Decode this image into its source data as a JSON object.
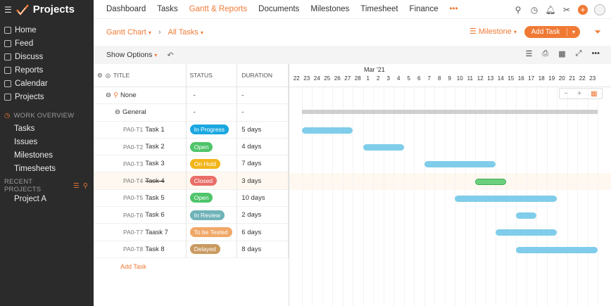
{
  "app": {
    "title": "Projects"
  },
  "sidebar": {
    "items": [
      {
        "label": "Home",
        "icon": "home-icon"
      },
      {
        "label": "Feed",
        "icon": "feed-icon"
      },
      {
        "label": "Discuss",
        "icon": "discuss-icon"
      },
      {
        "label": "Reports",
        "icon": "reports-icon"
      },
      {
        "label": "Calendar",
        "icon": "calendar-icon"
      },
      {
        "label": "Projects",
        "icon": "projects-icon"
      }
    ],
    "work_overview": {
      "heading": "WORK OVERVIEW",
      "items": [
        "Tasks",
        "Issues",
        "Milestones",
        "Timesheets"
      ]
    },
    "recent_projects": {
      "heading": "RECENT PROJECTS",
      "items": [
        "Project A"
      ]
    }
  },
  "topnav": {
    "tabs": [
      "Dashboard",
      "Tasks",
      "Gantt & Reports",
      "Documents",
      "Milestones",
      "Timesheet",
      "Finance"
    ],
    "active": "Gantt & Reports",
    "more": "•••"
  },
  "subbar": {
    "view": "Gantt Chart",
    "filter": "All Tasks",
    "milestone": "Milestone",
    "add_task": "Add Task"
  },
  "options": {
    "show_options": "Show Options"
  },
  "columns": {
    "title": "TITLE",
    "status": "STATUS",
    "duration": "DURATION"
  },
  "groups": [
    {
      "label": "None",
      "status": "-",
      "duration": "-"
    },
    {
      "label": "General",
      "status": "-",
      "duration": "-"
    }
  ],
  "colors": {
    "accent": "#f07a35",
    "bar": "#7fcdea",
    "closed_bar": "#6ccf7b",
    "group_bar": "#cfcfcf"
  },
  "tasks": [
    {
      "id": "PA0-T1",
      "name": "Task 1",
      "status": "In Progress",
      "color": "#1aa7e0",
      "duration": "5 days",
      "start": 1,
      "end": 6
    },
    {
      "id": "PA0-T2",
      "name": "Task 2",
      "status": "Open",
      "color": "#4fc46a",
      "duration": "4 days",
      "start": 7,
      "end": 11
    },
    {
      "id": "PA0-T3",
      "name": "Task 3",
      "status": "On Hold",
      "color": "#f2b51b",
      "duration": "7 days",
      "start": 13,
      "end": 20
    },
    {
      "id": "PA0-T4",
      "name": "Task 4",
      "status": "Closed",
      "color": "#e96d68",
      "duration": "3 days",
      "start": 18,
      "end": 21,
      "closed": true
    },
    {
      "id": "PA0-T5",
      "name": "Task 5",
      "status": "Open",
      "color": "#4fc46a",
      "duration": "10 days",
      "start": 16,
      "end": 26
    },
    {
      "id": "PA0-T6",
      "name": "Task 6",
      "status": "In Review",
      "color": "#6fb3b8",
      "duration": "2 days",
      "start": 22,
      "end": 24
    },
    {
      "id": "PA0-T7",
      "name": "Taask 7",
      "status": "To be Tested",
      "color": "#f0a868",
      "duration": "6 days",
      "start": 20,
      "end": 26
    },
    {
      "id": "PA0-T8",
      "name": "Task 8",
      "status": "Delayed",
      "color": "#c99a60",
      "duration": "8 days",
      "start": 22,
      "end": 30
    }
  ],
  "add_task_row": "Add Task",
  "timeline": {
    "month": "Mar '21",
    "days": [
      "22",
      "23",
      "24",
      "25",
      "26",
      "27",
      "28",
      "1",
      "2",
      "3",
      "4",
      "5",
      "6",
      "7",
      "8",
      "9",
      "10",
      "11",
      "12",
      "13",
      "14",
      "15",
      "16",
      "17",
      "18",
      "19",
      "20",
      "21",
      "22",
      "23"
    ]
  }
}
